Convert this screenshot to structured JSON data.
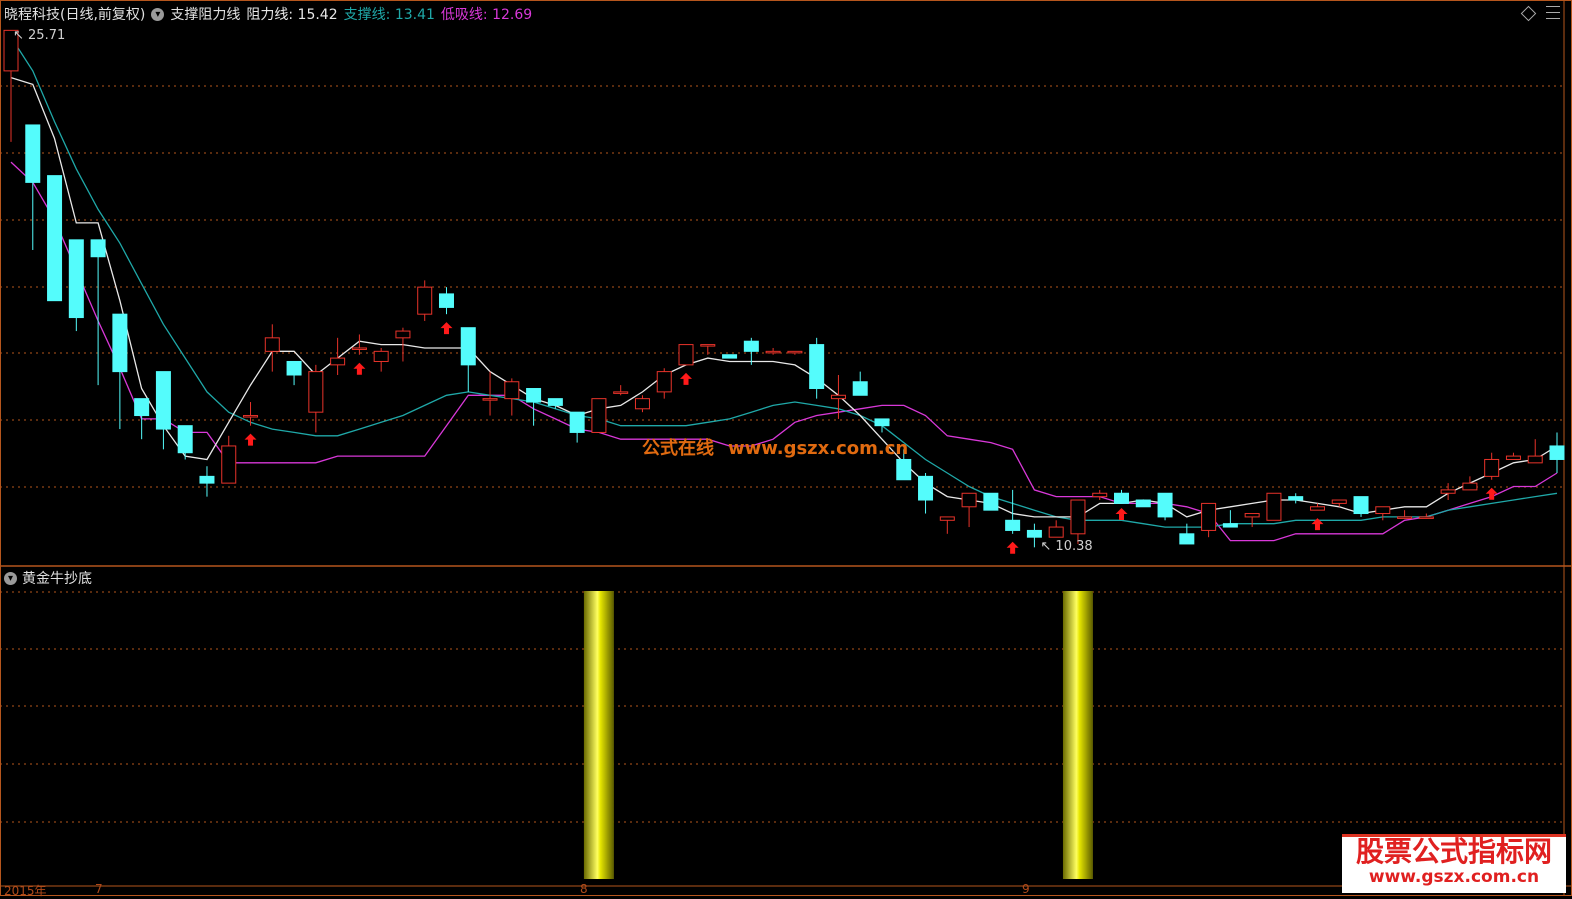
{
  "header": {
    "stock_title": "晓程科技(日线,前复权)",
    "indicator_name": "支撑阻力线",
    "resistance_label": "阻力线:",
    "resistance_value": "15.42",
    "support_label": "支撑线:",
    "support_value": "13.41",
    "low_label": "低吸线:",
    "low_value": "12.69"
  },
  "sub_panel": {
    "title": "黄金牛抄底"
  },
  "price_marks": {
    "high": "25.71",
    "low": "10.38"
  },
  "watermark": {
    "text1": "公式在线",
    "text2": "www.gszx.com.cn"
  },
  "logo": {
    "line1": "股票公式指标网",
    "line2": "www.gszx.com.cn"
  },
  "footer": {
    "date_left": "2015年",
    "tick1": "7",
    "tick2": "8",
    "tick3": "9"
  },
  "colors": {
    "up": "#e8332a",
    "down": "#54fcfc",
    "resistance": "#e8e8e8",
    "support": "#1fa8a8",
    "low_line": "#d838d8",
    "bar": "#e6e600",
    "grid": "#b5561d"
  },
  "chart_data": {
    "type": "candlestick",
    "price_range": [
      10.38,
      25.71
    ],
    "candles": [
      [
        24.5,
        25.7,
        22.4,
        25.7
      ],
      [
        22.9,
        22.9,
        19.2,
        21.2
      ],
      [
        21.4,
        21.4,
        17.7,
        17.7
      ],
      [
        19.5,
        19.5,
        16.8,
        17.2
      ],
      [
        19.5,
        19.5,
        15.2,
        19.0
      ],
      [
        17.3,
        17.3,
        13.9,
        15.6
      ],
      [
        14.8,
        14.8,
        13.6,
        14.3
      ],
      [
        15.6,
        15.6,
        13.3,
        13.9
      ],
      [
        14.0,
        14.0,
        13.0,
        13.2
      ],
      [
        12.5,
        12.8,
        11.9,
        12.3
      ],
      [
        12.3,
        13.7,
        12.3,
        13.4
      ],
      [
        14.3,
        14.7,
        14.0,
        14.3
      ],
      [
        16.2,
        17.0,
        15.6,
        16.6
      ],
      [
        15.9,
        15.9,
        15.2,
        15.5
      ],
      [
        14.4,
        15.8,
        13.8,
        15.6
      ],
      [
        15.8,
        16.6,
        15.5,
        16.0
      ],
      [
        16.3,
        16.7,
        16.1,
        16.3
      ],
      [
        15.9,
        16.3,
        15.6,
        16.2
      ],
      [
        16.6,
        16.9,
        15.9,
        16.8
      ],
      [
        17.3,
        18.3,
        17.1,
        18.1
      ],
      [
        17.9,
        18.1,
        17.3,
        17.5
      ],
      [
        16.9,
        16.9,
        15.0,
        15.8
      ],
      [
        14.8,
        15.6,
        14.3,
        14.8
      ],
      [
        14.8,
        15.4,
        14.3,
        15.3
      ],
      [
        15.1,
        15.1,
        14.0,
        14.7
      ],
      [
        14.8,
        14.8,
        14.5,
        14.6
      ],
      [
        14.4,
        14.4,
        13.5,
        13.8
      ],
      [
        13.8,
        14.8,
        13.8,
        14.8
      ],
      [
        15.0,
        15.2,
        14.9,
        15.0
      ],
      [
        14.5,
        14.9,
        14.4,
        14.8
      ],
      [
        15.0,
        15.7,
        14.8,
        15.6
      ],
      [
        15.8,
        16.2,
        15.8,
        16.4
      ],
      [
        16.4,
        16.4,
        16.1,
        16.4
      ],
      [
        16.1,
        16.1,
        16.0,
        16.0
      ],
      [
        16.5,
        16.6,
        15.8,
        16.2
      ],
      [
        16.2,
        16.3,
        16.1,
        16.2
      ],
      [
        16.2,
        16.2,
        16.1,
        16.2
      ],
      [
        16.4,
        16.6,
        14.8,
        15.1
      ],
      [
        14.8,
        15.5,
        14.2,
        14.9
      ],
      [
        15.3,
        15.6,
        15.0,
        14.9
      ],
      [
        14.2,
        14.2,
        13.8,
        14.0
      ],
      [
        13.0,
        13.3,
        12.4,
        12.4
      ],
      [
        12.5,
        12.6,
        11.4,
        11.8
      ],
      [
        11.2,
        11.2,
        10.8,
        11.3
      ],
      [
        11.6,
        11.8,
        11.0,
        12.0
      ],
      [
        12.0,
        12.0,
        11.5,
        11.5
      ],
      [
        11.2,
        12.1,
        10.8,
        10.9
      ],
      [
        10.9,
        11.1,
        10.4,
        10.7
      ],
      [
        10.7,
        11.2,
        10.7,
        11.0
      ],
      [
        10.8,
        10.8,
        10.5,
        11.8
      ],
      [
        11.9,
        12.1,
        11.8,
        12.0
      ],
      [
        12.0,
        12.1,
        11.8,
        11.7
      ],
      [
        11.8,
        11.8,
        11.7,
        11.6
      ],
      [
        12.0,
        12.0,
        11.2,
        11.3
      ],
      [
        10.8,
        11.1,
        10.5,
        10.5
      ],
      [
        10.9,
        10.9,
        10.7,
        11.7
      ],
      [
        11.1,
        11.5,
        11.0,
        11.0
      ],
      [
        11.3,
        11.3,
        11.0,
        11.4
      ],
      [
        11.2,
        11.2,
        11.2,
        12.0
      ],
      [
        11.9,
        12.0,
        11.7,
        11.8
      ],
      [
        11.5,
        11.7,
        11.5,
        11.6
      ],
      [
        11.7,
        11.8,
        11.6,
        11.8
      ],
      [
        11.9,
        11.9,
        11.3,
        11.4
      ],
      [
        11.4,
        11.6,
        11.2,
        11.6
      ],
      [
        11.3,
        11.5,
        11.3,
        11.3
      ],
      [
        11.3,
        11.4,
        11.3,
        11.3
      ],
      [
        12.0,
        12.3,
        11.8,
        12.1
      ],
      [
        12.1,
        12.5,
        12.1,
        12.3
      ],
      [
        12.5,
        13.2,
        12.4,
        13.0
      ],
      [
        13.0,
        13.2,
        13.0,
        13.1
      ],
      [
        12.9,
        13.6,
        12.9,
        13.1
      ],
      [
        13.4,
        13.8,
        12.6,
        13.0
      ]
    ],
    "resistance": [
      24.3,
      24.1,
      22.5,
      20.0,
      20.0,
      17.7,
      15.1,
      14.0,
      13.1,
      13.0,
      14.1,
      15.2,
      16.2,
      16.2,
      15.5,
      16.0,
      16.5,
      16.4,
      16.4,
      16.3,
      16.3,
      16.3,
      15.6,
      15.2,
      14.8,
      14.6,
      14.3,
      14.5,
      14.6,
      15.0,
      15.5,
      15.8,
      16.0,
      15.9,
      15.9,
      15.9,
      15.8,
      15.4,
      14.9,
      14.3,
      13.6,
      12.9,
      12.3,
      11.9,
      11.8,
      11.7,
      11.4,
      11.3,
      11.3,
      11.3,
      11.7,
      11.7,
      11.8,
      11.7,
      11.3,
      11.5,
      11.6,
      11.7,
      11.8,
      11.8,
      11.7,
      11.6,
      11.4,
      11.5,
      11.6,
      11.6,
      12.0,
      12.3,
      12.6,
      12.9,
      13.0,
      13.4
    ],
    "support": [
      25.5,
      24.5,
      23.0,
      21.6,
      20.4,
      19.4,
      18.2,
      17.0,
      16.0,
      15.0,
      14.4,
      14.1,
      13.9,
      13.8,
      13.7,
      13.7,
      13.9,
      14.1,
      14.3,
      14.6,
      14.9,
      15.0,
      14.9,
      14.8,
      14.7,
      14.5,
      14.3,
      14.2,
      14.0,
      14.0,
      14.0,
      14.0,
      14.1,
      14.2,
      14.4,
      14.6,
      14.7,
      14.6,
      14.5,
      14.3,
      14.0,
      13.5,
      13.0,
      12.6,
      12.2,
      11.9,
      11.7,
      11.5,
      11.3,
      11.2,
      11.2,
      11.2,
      11.1,
      11.0,
      11.0,
      11.0,
      11.1,
      11.1,
      11.1,
      11.2,
      11.2,
      11.2,
      11.2,
      11.3,
      11.3,
      11.3,
      11.5,
      11.6,
      11.7,
      11.8,
      11.9,
      12.0
    ],
    "low_line": [
      21.8,
      21.2,
      20.1,
      18.6,
      17.1,
      15.7,
      14.2,
      14.2,
      13.8,
      13.8,
      12.9,
      12.9,
      12.9,
      12.9,
      12.9,
      13.1,
      13.1,
      13.1,
      13.1,
      13.1,
      14.0,
      14.9,
      14.9,
      14.9,
      14.5,
      14.2,
      13.9,
      13.8,
      13.6,
      13.6,
      13.6,
      13.6,
      13.6,
      13.4,
      13.4,
      13.6,
      14.1,
      14.3,
      14.4,
      14.5,
      14.6,
      14.6,
      14.3,
      13.7,
      13.6,
      13.5,
      13.3,
      12.1,
      11.9,
      11.9,
      11.9,
      11.7,
      11.7,
      11.7,
      11.6,
      11.4,
      10.6,
      10.6,
      10.6,
      10.8,
      10.8,
      10.8,
      10.8,
      10.8,
      11.2,
      11.3,
      11.5,
      11.7,
      11.9,
      12.2,
      12.2,
      12.6
    ],
    "arrows": [
      11,
      16,
      20,
      31,
      46,
      51,
      60,
      68
    ],
    "signal_bars": [
      27,
      49
    ]
  }
}
